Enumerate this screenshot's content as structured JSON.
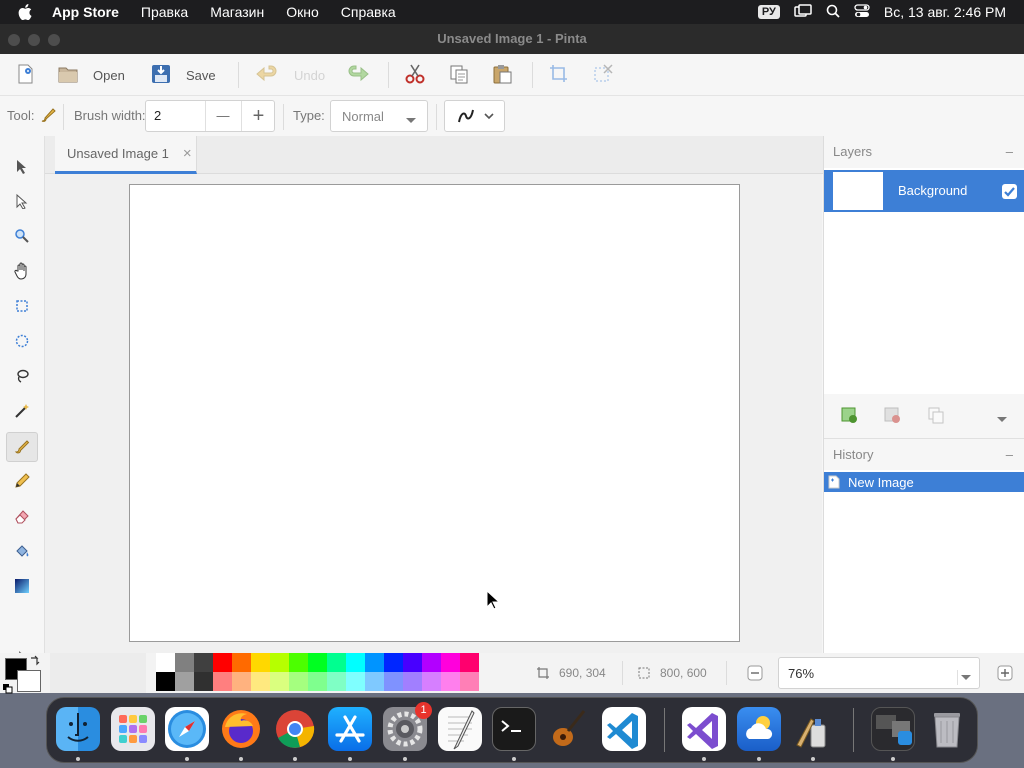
{
  "menubar": {
    "apple": "",
    "app_name": "App Store",
    "items": [
      "Правка",
      "Магазин",
      "Окно",
      "Справка"
    ],
    "input_lang": "РУ",
    "clock": "Вс, 13 авг.  2:46 PM"
  },
  "window": {
    "title": "Unsaved Image 1 - Pinta"
  },
  "toolbar": {
    "open_label": "Open",
    "save_label": "Save",
    "undo_label": "Undo"
  },
  "tool_options": {
    "tool_label": "Tool:",
    "brush_width_label": "Brush width:",
    "brush_width_value": "2",
    "minus": "—",
    "plus": "+",
    "type_label": "Type:",
    "type_value": "Normal"
  },
  "document_tab": {
    "title": "Unsaved Image 1",
    "close": "×"
  },
  "layers": {
    "header": "Layers",
    "collapse": "–",
    "items": [
      {
        "name": "Background",
        "visible": true
      }
    ]
  },
  "history": {
    "header": "History",
    "collapse": "–",
    "items": [
      "New Image"
    ]
  },
  "status": {
    "cursor_position": "690, 304",
    "image_size": "800, 600",
    "zoom": "76%"
  },
  "palette": {
    "primary_color": "#000000",
    "secondary_color": "#ffffff",
    "top_row": [
      "#ffffff",
      "#808080",
      "#404040",
      "#ff0000",
      "#ff6a00",
      "#ffd800",
      "#b6ff00",
      "#4cff00",
      "#00ff21",
      "#00ff90",
      "#00ffff",
      "#0094ff",
      "#0026ff",
      "#4800ff",
      "#b200ff",
      "#ff00dc",
      "#ff006e"
    ],
    "bottom_row": [
      "#000000",
      "#a0a0a0",
      "#303030",
      "#ff7f7f",
      "#ffb27f",
      "#ffe97f",
      "#daff7f",
      "#a5ff7f",
      "#7fff8e",
      "#7fffc5",
      "#7fffff",
      "#7fc9ff",
      "#7f92ff",
      "#a17fff",
      "#d67fff",
      "#ff7fed",
      "#ff7fb6"
    ]
  },
  "dock": {
    "apps": [
      "finder",
      "launchpad",
      "safari",
      "firefox",
      "chrome",
      "app-store",
      "system-settings",
      "textedit",
      "terminal",
      "garageband",
      "vscode",
      "visual-studio",
      "weather",
      "pinta",
      "activity-monitor",
      "trash"
    ],
    "settings_badge": "1"
  }
}
